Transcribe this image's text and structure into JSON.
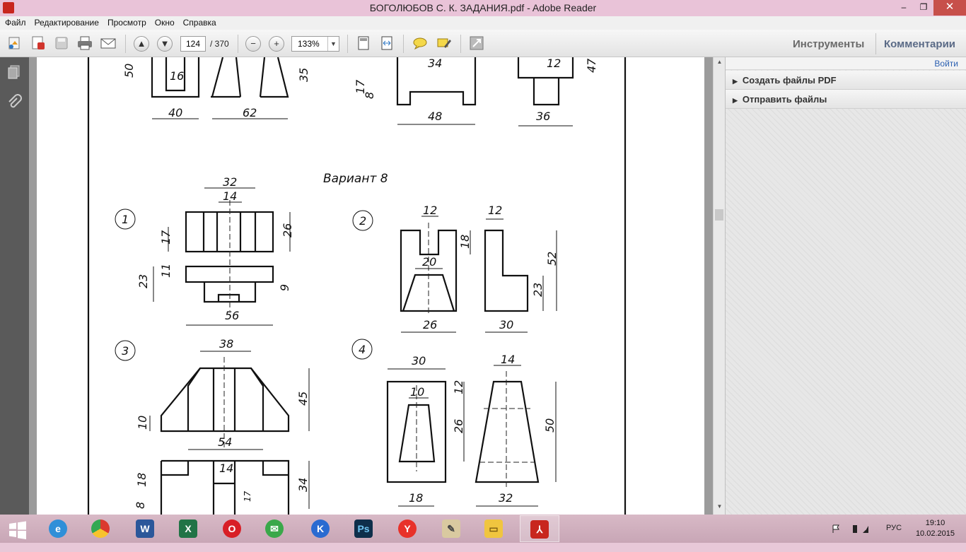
{
  "window": {
    "title": "БОГОЛЮБОВ С. К. ЗАДАНИЯ.pdf - Adobe Reader",
    "minimize_glyph": "–",
    "restore_glyph": "❐",
    "close_glyph": "✕"
  },
  "menu": [
    "Файл",
    "Редактирование",
    "Просмотр",
    "Окно",
    "Справка"
  ],
  "toolbar": {
    "current_page": "124",
    "total_pages": "/ 370",
    "zoom": "133%",
    "tools_label": "Инструменты",
    "comments_label": "Комментарии"
  },
  "right_panel": {
    "signin": "Войти",
    "sections": [
      "Создать файлы PDF",
      "Отправить файлы"
    ]
  },
  "document": {
    "variant_title": "Вариант 8",
    "top_dims": [
      "50",
      "16",
      "40",
      "62",
      "35",
      "17",
      "8",
      "34",
      "48",
      "12",
      "47",
      "36"
    ],
    "task1": {
      "number": "1",
      "dims": [
        "32",
        "14",
        "17",
        "26",
        "23",
        "11",
        "9",
        "56"
      ]
    },
    "task2": {
      "number": "2",
      "dims": [
        "12",
        "18",
        "20",
        "26",
        "12",
        "52",
        "23",
        "30"
      ]
    },
    "task3": {
      "number": "3",
      "dims": [
        "38",
        "10",
        "45",
        "54",
        "14",
        "18",
        "8",
        "34",
        "17"
      ]
    },
    "task4": {
      "number": "4",
      "dims": [
        "30",
        "10",
        "12",
        "26",
        "18",
        "14",
        "50",
        "32"
      ]
    }
  },
  "taskbar": {
    "language": "РУС",
    "time": "19:10",
    "date": "10.02.2015",
    "apps": [
      "start",
      "internet-explorer",
      "chrome",
      "word",
      "excel",
      "opera",
      "skype-like",
      "yandex-k",
      "photoshop",
      "yandex-browser",
      "notepad",
      "file-explorer",
      "adobe-reader"
    ]
  },
  "colors": {
    "titlebar": "#e9c3d8",
    "close_button": "#c7504a",
    "link_blue": "#2a5fb1",
    "left_panel": "#5a5a5a"
  }
}
